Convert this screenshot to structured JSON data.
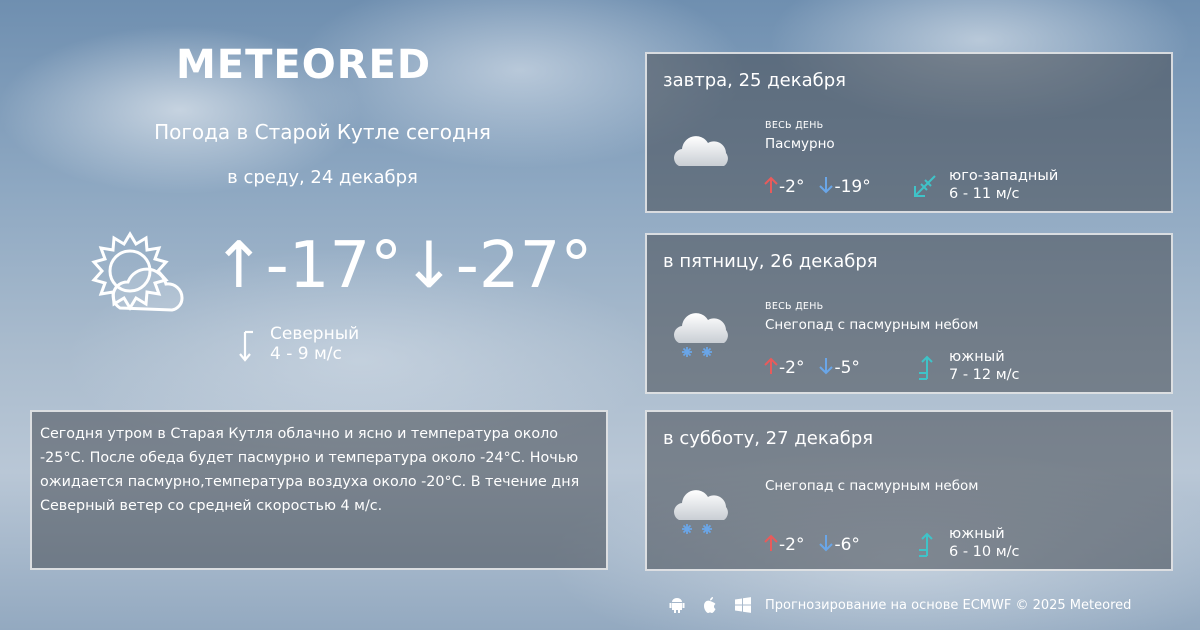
{
  "brand": {
    "logo": "METEORED"
  },
  "today": {
    "title": "Погода в Старой Кутле сегодня",
    "date": "в среду, 24 декабря",
    "icon": "partly-cloudy-sun-icon",
    "temp_max": "-17°",
    "temp_min": "-27°",
    "wind_dir": "Северный",
    "wind_speed": "4 - 9 м/с",
    "description": "Сегодня утром в Старая Кутля облачно и ясно и температура около -25°C. После обеда будет пасмурно и температура около  -24°C. Ночью ожидается пасмурно,температура воздуха около -20°C. В течение дня Северный ветер со средней скоростью 4 м/с."
  },
  "forecast": [
    {
      "title": "завтра, 25 декабря",
      "period": "ВЕСЬ ДЕНЬ",
      "condition": "Пасмурно",
      "icon": "cloud-icon",
      "temp_max": "-2°",
      "temp_min": "-19°",
      "wind_dir": "юго-западный",
      "wind_speed": "6 - 11 м/с"
    },
    {
      "title": "в пятницу, 26 декабря",
      "period": "ВЕСЬ ДЕНЬ",
      "condition": "Снегопад с пасмурным небом",
      "icon": "snow-cloud-icon",
      "temp_max": "-2°",
      "temp_min": "-5°",
      "wind_dir": "южный",
      "wind_speed": "7 - 12 м/с"
    },
    {
      "title": "в субботу, 27 декабря",
      "period": "",
      "condition": "Снегопад с пасмурным небом",
      "icon": "snow-cloud-icon",
      "temp_max": "-2°",
      "temp_min": "-6°",
      "wind_dir": "южный",
      "wind_speed": "6 - 10 м/с"
    }
  ],
  "footer": {
    "text": "Прогнозирование на основе ECMWF © 2025 Meteored"
  },
  "colors": {
    "up_arrow": "#e85b5b",
    "down_arrow": "#6aa6e8",
    "wind": "#3fc3c8"
  }
}
